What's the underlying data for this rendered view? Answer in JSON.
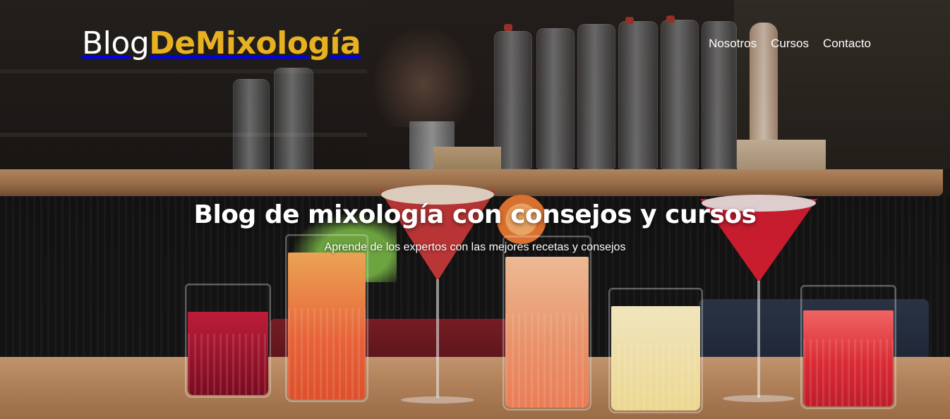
{
  "header": {
    "logo": {
      "part1": "Blog",
      "part2": "DeMixología"
    },
    "nav": [
      {
        "label": "Nosotros"
      },
      {
        "label": "Cursos"
      },
      {
        "label": "Contacto"
      }
    ]
  },
  "hero": {
    "title": "Blog de mixología con consejos y cursos",
    "subtitle": "Aprende de los expertos con las mejores recetas y consejos"
  },
  "colors": {
    "logo_accent": "#e7b121",
    "text": "#ffffff"
  }
}
